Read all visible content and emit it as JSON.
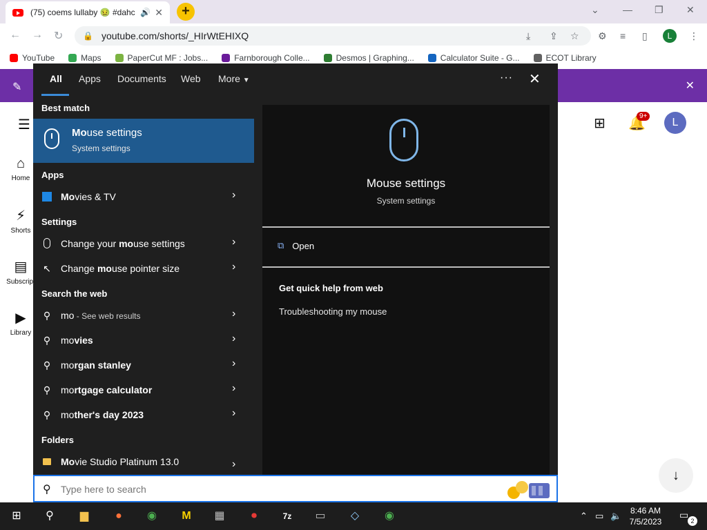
{
  "browser": {
    "tab_title": "(75) coems lullaby 🤢 #dahc",
    "url": "youtube.com/shorts/_HIrWtEHIXQ",
    "profile_initial": "L",
    "bookmarks": [
      "YouTube",
      "Maps",
      "PaperCut MF : Jobs...",
      "Farnborough Colle...",
      "Desmos | Graphing...",
      "Calculator Suite - G...",
      "ECOT Library"
    ]
  },
  "youtube": {
    "nav": [
      "Home",
      "Shorts",
      "Subscript",
      "Library"
    ],
    "notification_count": "9+",
    "avatar_initial": "L"
  },
  "search": {
    "tabs": {
      "all": "All",
      "apps": "Apps",
      "documents": "Documents",
      "web": "Web",
      "more": "More"
    },
    "sections": {
      "best_match": "Best match",
      "apps": "Apps",
      "settings": "Settings",
      "search_web": "Search the web",
      "folders": "Folders"
    },
    "best_match": {
      "title_bold": "Mo",
      "title_rest": "use settings",
      "subtitle": "System settings"
    },
    "apps": [
      {
        "bold": "Mo",
        "rest": "vies & TV"
      }
    ],
    "settings": [
      {
        "pre": "Change your ",
        "bold": "mo",
        "rest": "use settings"
      },
      {
        "pre": "Change ",
        "bold": "mo",
        "rest": "use pointer size"
      }
    ],
    "web": [
      {
        "text": "mo",
        "sub": " - See web results"
      },
      {
        "pre": "mo",
        "bold": "vies"
      },
      {
        "pre": "mo",
        "bold": "rgan stanley"
      },
      {
        "pre": "mo",
        "bold": "rtgage calculator"
      },
      {
        "pre": "mo",
        "bold": "ther's day 2023"
      }
    ],
    "folders": [
      {
        "bold": "Mo",
        "rest": "vie Studio Platinum 13.0"
      }
    ],
    "preview": {
      "title": "Mouse settings",
      "subtitle": "System settings",
      "open": "Open",
      "quick_help": "Get quick help from web",
      "help_link": "Troubleshooting my mouse"
    },
    "input_placeholder": "Type here to search"
  },
  "taskbar": {
    "time": "8:46 AM",
    "date": "7/5/2023",
    "notification_count": "2"
  }
}
